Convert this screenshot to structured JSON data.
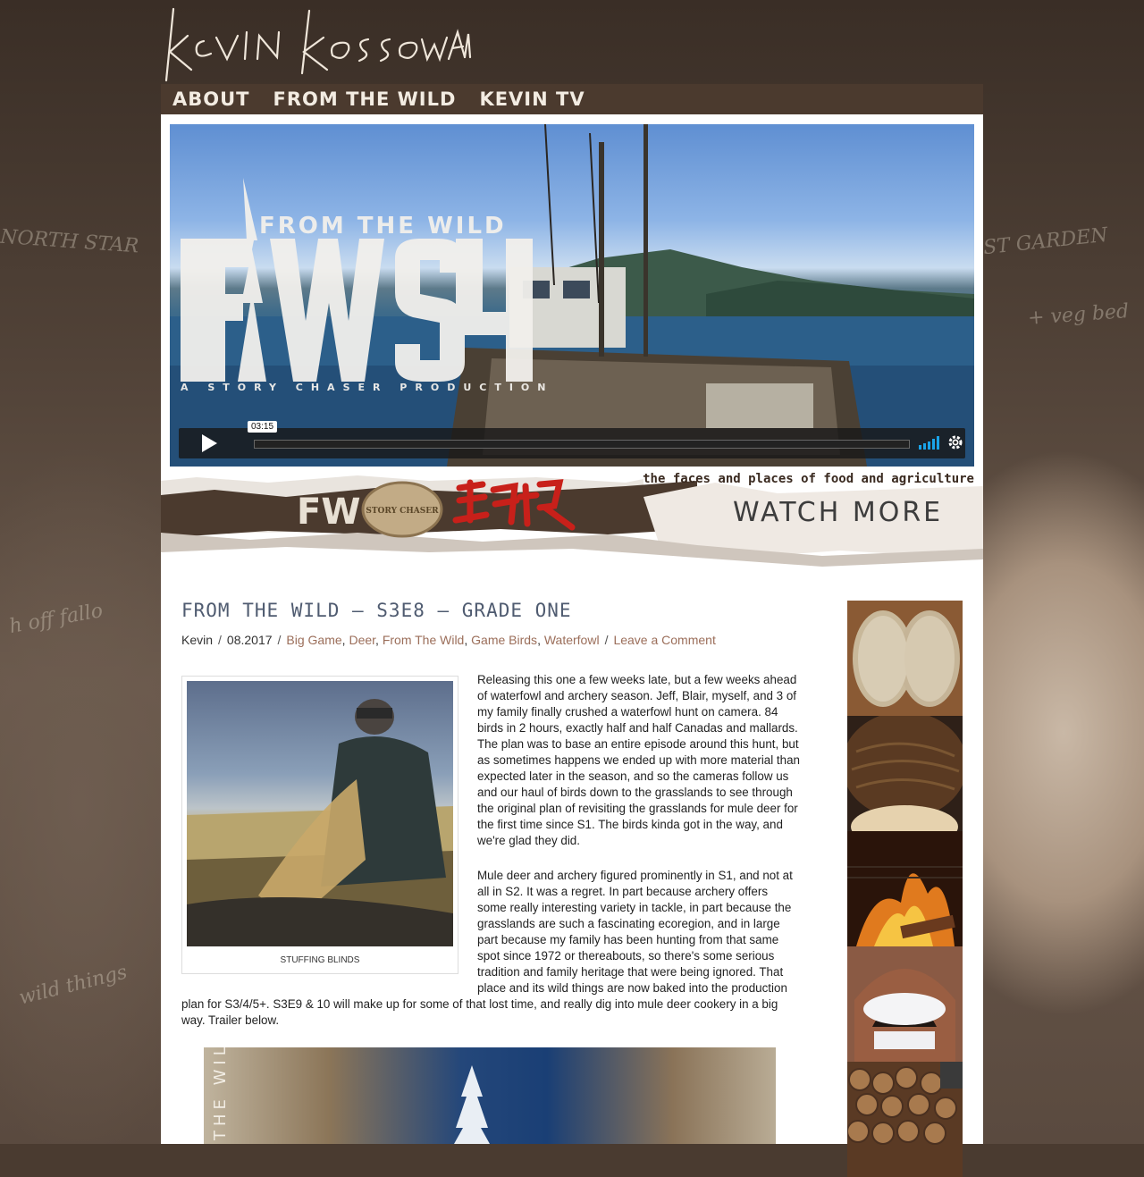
{
  "site": {
    "logo_text": "Kevin Kossowan"
  },
  "nav": {
    "items": [
      {
        "label": "ABOUT"
      },
      {
        "label": "FROM THE WILD"
      },
      {
        "label": "KEVIN TV"
      }
    ]
  },
  "video": {
    "overlay_title_top": "FROM THE WILD",
    "overlay_title_big": "FWS4",
    "overlay_subtitle": "A STORY CHASER PRODUCTION",
    "timecode": "03:15"
  },
  "banner": {
    "tagline": "the faces and places of food and agriculture",
    "watch_more": "WATCH MORE",
    "fw_logo": "FW",
    "story_chaser_logo": "STORY CHASER"
  },
  "post": {
    "title": "FROM THE WILD – S3E8 – GRADE ONE",
    "author": "Kevin",
    "date": "08.2017",
    "categories": [
      {
        "label": "Big Game"
      },
      {
        "label": "Deer"
      },
      {
        "label": "From The Wild"
      },
      {
        "label": "Game Birds"
      },
      {
        "label": "Waterfowl"
      }
    ],
    "comment_link": "Leave a Comment",
    "image_caption": "STUFFING BLINDS",
    "paragraphs": [
      "Releasing this one a few weeks late, but a few weeks ahead of waterfowl and archery season. Jeff, Blair, myself, and 3 of my family finally crushed a waterfowl hunt on camera. 84 birds in 2 hours, exactly half and half Canadas and mallards. The plan was to base an entire episode around this hunt, but as sometimes happens we ended up with more material than expected later in the season, and so the cameras follow us and our haul of birds down to the grasslands to see through the original plan of revisiting the grasslands for mule deer for the first time since S1. The birds kinda got in the way, and we're glad they did.",
      "Mule deer and archery figured prominently in S1, and not at all in S2. It was a regret. In part because archery offers some really interesting variety in tackle, in part because the grasslands are such a fascinating ecoregion, and in large part because my family has been hunting from that same spot since 1972 or thereabouts, so there's some serious tradition and family heritage that were being ignored. That place and its wild things are now baked into the production plan for S3/4/5+. S3E9 & 10 will make up for some of that lost time, and really dig into mule deer cookery in a big way. Trailer below."
    ],
    "trailer_text": "THE WILD"
  },
  "colors": {
    "nav_bg": "#4b3a2e",
    "title_color": "#4f5b70",
    "link_color": "#9b6e5a",
    "banner_red": "#c8201a"
  }
}
